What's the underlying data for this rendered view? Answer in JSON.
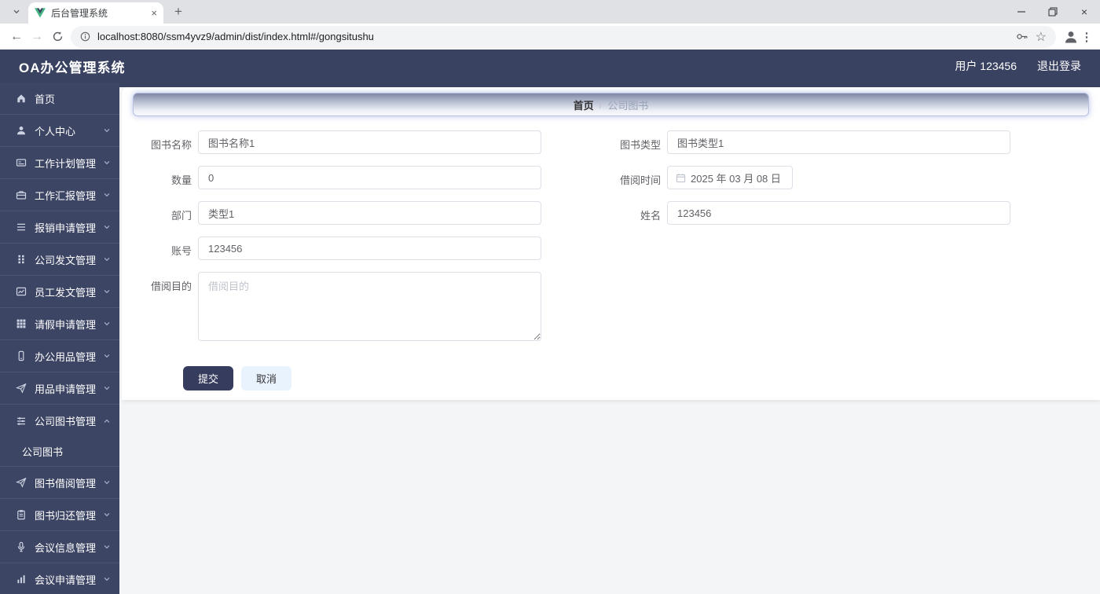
{
  "browser": {
    "tab_title": "后台管理系统",
    "url": "localhost:8080/ssm4yvz9/admin/dist/index.html#/gongsituhu",
    "url_shown": "localhost:8080/ssm4yvz9/admin/dist/index.html#/gongsitushu",
    "new_tab_label": "+",
    "close_tab_label": "×"
  },
  "header": {
    "title": "OA办公管理系统",
    "user": "用户 123456",
    "logout": "退出登录"
  },
  "sidebar": {
    "items": [
      {
        "label": "首页",
        "icon": "home-icon",
        "chevron": "none"
      },
      {
        "label": "个人中心",
        "icon": "user-icon",
        "chevron": "down"
      },
      {
        "label": "工作计划管理",
        "icon": "card-icon",
        "chevron": "down"
      },
      {
        "label": "工作汇报管理",
        "icon": "briefcase-icon",
        "chevron": "down"
      },
      {
        "label": "报销申请管理",
        "icon": "list-icon",
        "chevron": "down"
      },
      {
        "label": "公司发文管理",
        "icon": "grid-icon",
        "chevron": "down"
      },
      {
        "label": "员工发文管理",
        "icon": "chart-icon",
        "chevron": "down"
      },
      {
        "label": "请假申请管理",
        "icon": "table-icon",
        "chevron": "down"
      },
      {
        "label": "办公用品管理",
        "icon": "phone-icon",
        "chevron": "down"
      },
      {
        "label": "用品申请管理",
        "icon": "send-icon",
        "chevron": "down"
      },
      {
        "label": "公司图书管理",
        "icon": "sliders-icon",
        "chevron": "up",
        "children": [
          {
            "label": "公司图书"
          }
        ]
      },
      {
        "label": "图书借阅管理",
        "icon": "send-icon",
        "chevron": "down"
      },
      {
        "label": "图书归还管理",
        "icon": "clipboard-icon",
        "chevron": "down"
      },
      {
        "label": "会议信息管理",
        "icon": "mic-icon",
        "chevron": "down"
      },
      {
        "label": "会议申请管理",
        "icon": "bars-icon",
        "chevron": "down"
      }
    ]
  },
  "breadcrumb": {
    "home": "首页",
    "separator": "/",
    "current": "公司图书"
  },
  "form": {
    "left_fields": [
      {
        "label": "图书名称",
        "type": "text",
        "value": "图书名称1"
      },
      {
        "label": "数量",
        "type": "text",
        "value": "0"
      },
      {
        "label": "部门",
        "type": "text",
        "value": "类型1"
      },
      {
        "label": "账号",
        "type": "text",
        "value": "123456"
      },
      {
        "label": "借阅目的",
        "type": "textarea",
        "value": "",
        "placeholder": "借阅目的"
      }
    ],
    "right_fields": [
      {
        "label": "图书类型",
        "type": "text",
        "value": "图书类型1"
      },
      {
        "label": "借阅时间",
        "type": "date",
        "value": "2025 年 03 月 08 日"
      },
      {
        "label": "姓名",
        "type": "text",
        "value": "123456"
      }
    ],
    "submit_label": "提交",
    "cancel_label": "取消"
  }
}
